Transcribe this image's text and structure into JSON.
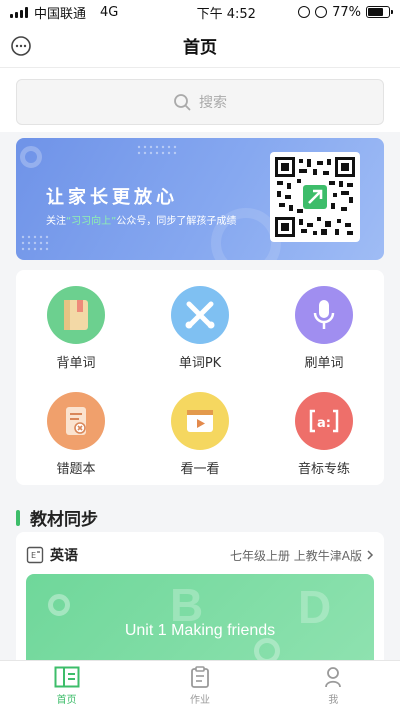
{
  "status_bar": {
    "carrier": "中国联通",
    "network": "4G",
    "time": "下午 4:52",
    "battery": "77%",
    "battery_level": 0.77
  },
  "nav": {
    "title": "首页"
  },
  "search": {
    "placeholder": "搜索"
  },
  "banner": {
    "title": "让家长更放心",
    "sub_prefix": "关注",
    "sub_highlight": "“习习向上”",
    "sub_suffix": "公众号，同步了解孩子成绩"
  },
  "features": [
    {
      "label": "背单词",
      "color": "#6cd08f",
      "icon": "book-icon"
    },
    {
      "label": "单词PK",
      "color": "#7fc0f2",
      "icon": "crossed-swords-icon"
    },
    {
      "label": "刷单词",
      "color": "#a08ef0",
      "icon": "microphone-icon"
    },
    {
      "label": "错题本",
      "color": "#f0a06c",
      "icon": "notebook-x-icon"
    },
    {
      "label": "看一看",
      "color": "#f5d760",
      "icon": "play-video-icon"
    },
    {
      "label": "音标专练",
      "color": "#ee6f6a",
      "icon": "phonetic-icon"
    }
  ],
  "section": {
    "title": "教材同步"
  },
  "book": {
    "subject": "英语",
    "grade": "七年级上册 上教牛津A版",
    "unit": "Unit 1 Making friends"
  },
  "tabs": [
    {
      "label": "首页",
      "active": true,
      "icon": "home-icon"
    },
    {
      "label": "作业",
      "active": false,
      "icon": "clipboard-icon"
    },
    {
      "label": "我",
      "active": false,
      "icon": "person-icon"
    }
  ],
  "colors": {
    "accent": "#3dbd6a",
    "banner": "#7b9ef0"
  }
}
